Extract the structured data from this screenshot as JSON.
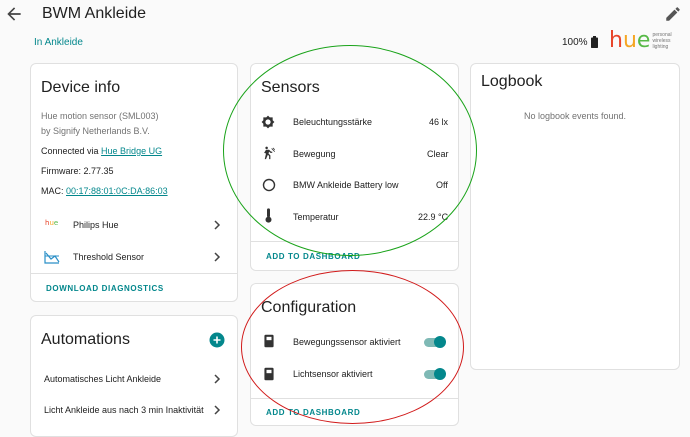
{
  "header": {
    "title": "BWM Ankleide",
    "area_link": "In Ankleide",
    "battery": "100%",
    "hue_logo": "hue",
    "hue_tagline": "personal wireless lighting"
  },
  "device_info": {
    "title": "Device info",
    "model": "Hue motion sensor (SML003)",
    "manufacturer": "by Signify Netherlands B.V.",
    "connected_prefix": "Connected via ",
    "connected_link": "Hue Bridge UG",
    "firmware": "Firmware: 2.77.35",
    "mac_prefix": "MAC: ",
    "mac_link": "00:17:88:01:0C:DA:86:03",
    "integrations": [
      {
        "label": "Philips Hue",
        "icon": "hue-logo-icon"
      },
      {
        "label": "Threshold Sensor",
        "icon": "threshold-icon"
      }
    ],
    "download_label": "DOWNLOAD DIAGNOSTICS"
  },
  "automations": {
    "title": "Automations",
    "items": [
      "Automatisches Licht Ankleide",
      "Licht Ankleide aus nach 3 min Inaktivität"
    ]
  },
  "sensors": {
    "title": "Sensors",
    "rows": [
      {
        "label": "Beleuchtungsstärke",
        "value": "46 lx",
        "icon": "brightness-icon"
      },
      {
        "label": "Bewegung",
        "value": "Clear",
        "icon": "motion-icon"
      },
      {
        "label": "BMW Ankleide Battery low",
        "value": "Off",
        "icon": "battery-low-circle-icon"
      },
      {
        "label": "Temperatur",
        "value": "22.9 °C",
        "icon": "thermometer-icon"
      }
    ],
    "add_label": "ADD TO DASHBOARD"
  },
  "configuration": {
    "title": "Configuration",
    "rows": [
      {
        "label": "Bewegungssensor aktiviert",
        "on": true
      },
      {
        "label": "Lichtsensor aktiviert",
        "on": true
      }
    ],
    "add_label": "ADD TO DASHBOARD"
  },
  "logbook": {
    "title": "Logbook",
    "empty": "No logbook events found."
  },
  "colors": {
    "accent": "#03878c",
    "annotation_green": "#1aa31a",
    "annotation_red": "#d11a1a"
  }
}
